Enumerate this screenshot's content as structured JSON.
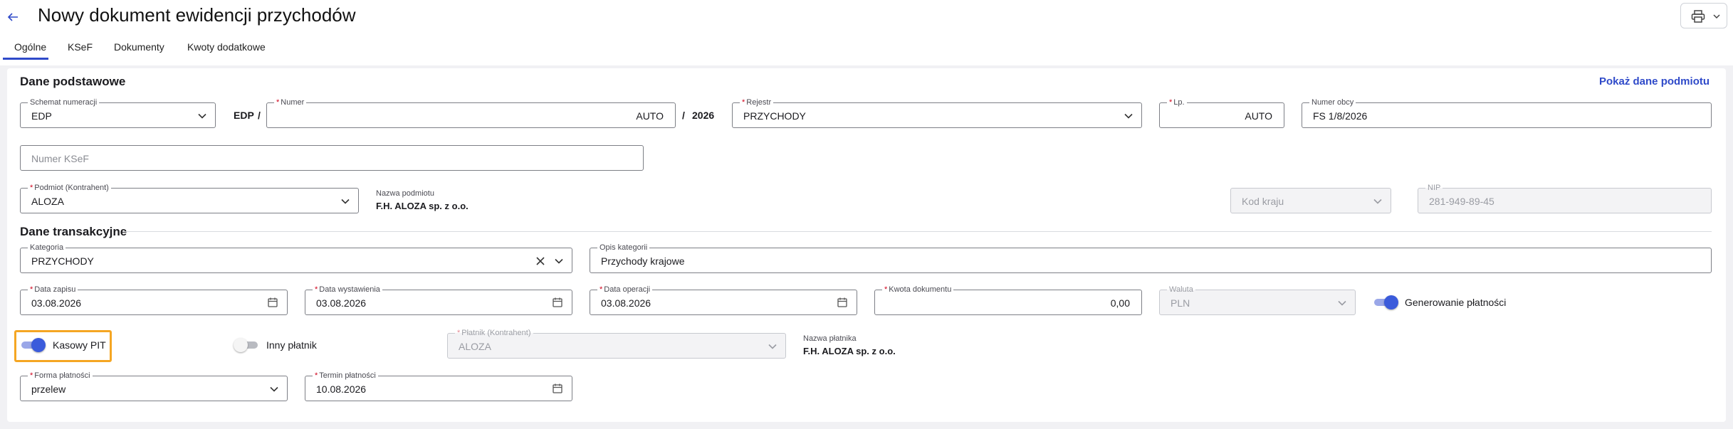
{
  "header": {
    "title": "Nowy dokument ewidencji przychodów"
  },
  "icons": {
    "back": "arrow-left-icon",
    "print": "printer-icon",
    "chevron": "chevron-down-icon",
    "calendar": "calendar-icon",
    "clear": "close-icon"
  },
  "tabs": [
    {
      "label": "Ogólne",
      "active": true
    },
    {
      "label": "KSeF",
      "active": false
    },
    {
      "label": "Dokumenty",
      "active": false
    },
    {
      "label": "Kwoty dodatkowe",
      "active": false
    }
  ],
  "basic": {
    "section_title": "Dane podstawowe",
    "show_entity_link": "Pokaż dane podmiotu",
    "schemat": {
      "label": "Schemat numeracji",
      "value": "EDP"
    },
    "prefix": "EDP",
    "slash": "/",
    "numer": {
      "label": "Numer",
      "value": "AUTO"
    },
    "year_sep": "/",
    "year": "2026",
    "rejestr": {
      "label": "Rejestr",
      "value": "PRZYCHODY"
    },
    "lp": {
      "label": "Lp.",
      "value": "AUTO"
    },
    "numer_obcy": {
      "label": "Numer obcy",
      "value": "FS 1/8/2026"
    },
    "ksef": {
      "placeholder": "Numer KSeF"
    },
    "podmiot": {
      "label": "Podmiot (Kontrahent)",
      "value": "ALOZA"
    },
    "nazwa_podmiotu": {
      "label": "Nazwa podmiotu",
      "value": "F.H. ALOZA sp. z o.o."
    },
    "kod_kraju": {
      "placeholder": "Kod kraju"
    },
    "nip": {
      "label": "NIP",
      "value": "281-949-89-45"
    }
  },
  "transaction": {
    "section_title": "Dane transakcyjne",
    "kategoria": {
      "label": "Kategoria",
      "value": "PRZYCHODY"
    },
    "opis_kategorii": {
      "label": "Opis kategorii",
      "value": "Przychody krajowe"
    },
    "data_zapisu": {
      "label": "Data zapisu",
      "value": "03.08.2026"
    },
    "data_wystawienia": {
      "label": "Data wystawienia",
      "value": "03.08.2026"
    },
    "data_operacji": {
      "label": "Data operacji",
      "value": "03.08.2026"
    },
    "kwota": {
      "label": "Kwota dokumentu",
      "value": "0,00"
    },
    "waluta": {
      "label": "Waluta",
      "value": "PLN"
    },
    "generowanie": {
      "label": "Generowanie płatności",
      "on": true
    },
    "kasowy_pit": {
      "label": "Kasowy PIT",
      "on": true
    },
    "inny_platnik": {
      "label": "Inny płatnik",
      "on": false
    },
    "platnik": {
      "label": "Płatnik (Kontrahent)",
      "value": "ALOZA"
    },
    "nazwa_platnika": {
      "label": "Nazwa płatnika",
      "value": "F.H. ALOZA sp. z o.o."
    },
    "forma_platnosci": {
      "label": "Forma płatności",
      "value": "przelew"
    },
    "termin_platnosci": {
      "label": "Termin płatności",
      "value": "10.08.2026"
    }
  },
  "colors": {
    "accent": "#2f4ac9",
    "required": "#d0021b",
    "highlight": "#f5a623"
  }
}
